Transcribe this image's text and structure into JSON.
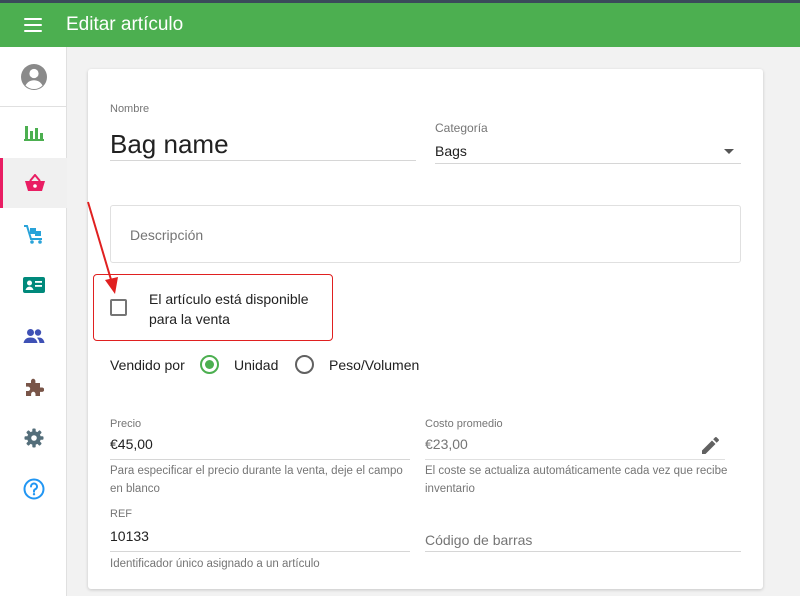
{
  "header": {
    "title": "Editar artículo",
    "accent": "#4caf50"
  },
  "sidebar": {
    "items": [
      {
        "icon": "account-circle-icon"
      },
      {
        "icon": "bar-chart-icon"
      },
      {
        "icon": "basket-icon",
        "active": true
      },
      {
        "icon": "cart-icon"
      },
      {
        "icon": "id-card-icon"
      },
      {
        "icon": "people-icon"
      },
      {
        "icon": "puzzle-icon"
      },
      {
        "icon": "gear-icon"
      },
      {
        "icon": "help-icon"
      }
    ],
    "active_color": "#e91e63"
  },
  "form": {
    "name": {
      "label": "Nombre",
      "value": "Bag name"
    },
    "category": {
      "label": "Categoría",
      "value": "Bags"
    },
    "description": {
      "placeholder": "Descripción"
    },
    "available": {
      "label": "El artículo está disponible para la venta",
      "checked": false
    },
    "sold_by": {
      "label": "Vendido por",
      "options": [
        "Unidad",
        "Peso/Volumen"
      ],
      "selected": "Unidad"
    },
    "price": {
      "label": "Precio",
      "value": "€45,00",
      "helper": "Para especificar el precio durante la venta, deje el campo en blanco"
    },
    "cost": {
      "label": "Costo promedio",
      "value": "€23,00",
      "helper": "El coste se actualiza automáticamente cada vez que recibe inventario"
    },
    "ref": {
      "label": "REF",
      "value": "10133",
      "helper": "Identificador único asignado a un artículo"
    },
    "barcode": {
      "placeholder": "Código de barras"
    }
  },
  "annotation_color": "#e02020"
}
